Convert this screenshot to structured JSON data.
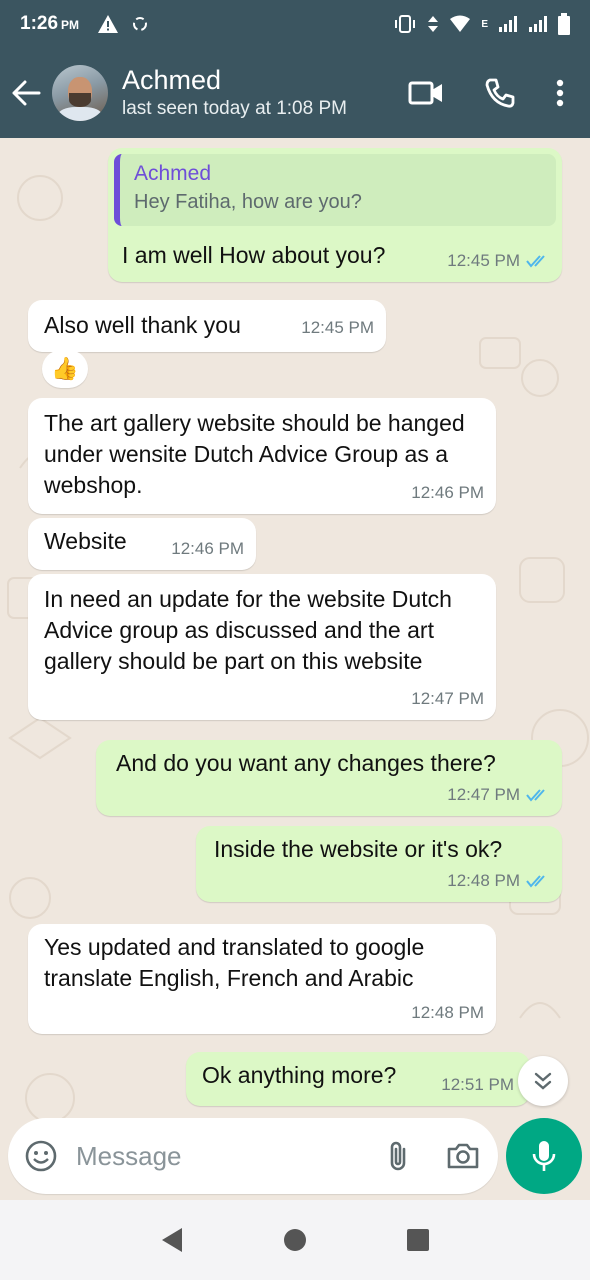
{
  "status_bar": {
    "time": "1:26",
    "ampm": "PM",
    "network_label": "E"
  },
  "header": {
    "contact_name": "Achmed",
    "last_seen": "last seen today at 1:08 PM"
  },
  "messages": [
    {
      "direction": "out",
      "quoted_name": "Achmed",
      "quoted_text": "Hey Fatiha, how are you?",
      "text": "I am well How about you?",
      "time": "12:45 PM",
      "status": "read"
    },
    {
      "direction": "in",
      "text": "Also well thank you",
      "time": "12:45 PM",
      "reaction": "👍"
    },
    {
      "direction": "in",
      "text": "The art gallery website should be hanged under wensite Dutch Advice Group as a webshop.",
      "time": "12:46 PM"
    },
    {
      "direction": "in",
      "text": "Website",
      "time": "12:46 PM"
    },
    {
      "direction": "in",
      "text": "In need an update for the website Dutch Advice group as discussed and the art gallery should be part on this website",
      "time": "12:47 PM"
    },
    {
      "direction": "out",
      "text": "And do you want any changes there?",
      "time": "12:47 PM",
      "status": "read"
    },
    {
      "direction": "out",
      "text": "Inside the website or it's ok?",
      "time": "12:48 PM",
      "status": "read"
    },
    {
      "direction": "in",
      "text": "Yes updated and translated to google translate English, French and Arabic",
      "time": "12:48 PM"
    },
    {
      "direction": "out",
      "text": "Ok anything more?",
      "time": "12:51 PM",
      "status": "read"
    }
  ],
  "composer": {
    "placeholder": "Message"
  },
  "colors": {
    "header_bg": "#3b5560",
    "incoming_bubble": "#ffffff",
    "outgoing_bubble": "#dcf8c6",
    "read_tick": "#4fb6ec",
    "accent_fab": "#00a884",
    "quote_bar": "#6e4ed8"
  },
  "icons": {
    "status_left": [
      "warning-icon",
      "recycle-icon"
    ],
    "status_right": [
      "vibrate-icon",
      "data-arrows-icon",
      "wifi-icon",
      "signal-icon",
      "signal-icon",
      "battery-icon"
    ],
    "header": [
      "back-arrow-icon",
      "video-call-icon",
      "phone-icon",
      "more-vert-icon"
    ],
    "composer": [
      "emoji-icon",
      "attach-icon",
      "camera-icon",
      "mic-icon"
    ],
    "nav": [
      "nav-back-icon",
      "nav-home-icon",
      "nav-recents-icon"
    ]
  }
}
